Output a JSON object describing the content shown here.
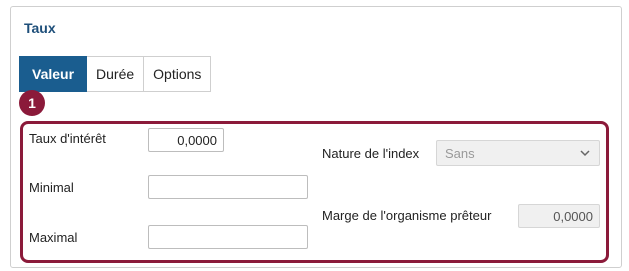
{
  "section": {
    "title": "Taux"
  },
  "tabs": [
    {
      "label": "Valeur",
      "active": true
    },
    {
      "label": "Durée",
      "active": false
    },
    {
      "label": "Options",
      "active": false
    }
  ],
  "callout": {
    "number": "1",
    "color": "#8b1a3a"
  },
  "form": {
    "taux_interet": {
      "label": "Taux d'intérêt",
      "value": "0,0000"
    },
    "minimal": {
      "label": "Minimal",
      "value": ""
    },
    "maximal": {
      "label": "Maximal",
      "value": ""
    },
    "nature_index": {
      "label": "Nature de l'index",
      "value": "Sans"
    },
    "marge": {
      "label": "Marge de l'organisme prêteur",
      "value": "0,0000"
    }
  },
  "colors": {
    "accent": "#1a5d8f",
    "title": "#1e4f7a"
  }
}
